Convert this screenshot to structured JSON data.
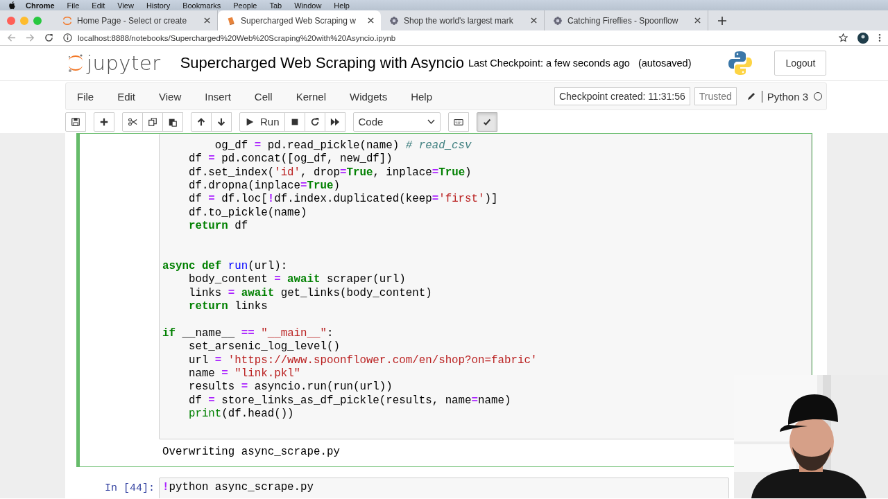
{
  "menu_bar": {
    "app": "Chrome",
    "items": [
      "File",
      "Edit",
      "View",
      "History",
      "Bookmarks",
      "People",
      "Tab",
      "Window",
      "Help"
    ]
  },
  "browser": {
    "tabs": [
      {
        "title": "Home Page - Select or create",
        "kind": "jupyter",
        "selected": false
      },
      {
        "title": "Supercharged Web Scraping w",
        "kind": "book",
        "selected": true
      },
      {
        "title": "Shop the world's largest mark",
        "kind": "flower",
        "selected": false
      },
      {
        "title": "Catching Fireflies - Spoonflow",
        "kind": "flower",
        "selected": false
      }
    ],
    "address": "localhost:8888/notebooks/Supercharged%20Web%20Scraping%20with%20Asyncio.ipynb"
  },
  "notebook": {
    "logo_text": "jupyter",
    "title": "Supercharged Web Scraping with Asyncio",
    "checkpoint": "Last Checkpoint: a few seconds ago",
    "autosave": "(autosaved)",
    "logout": "Logout",
    "menu": [
      "File",
      "Edit",
      "View",
      "Insert",
      "Cell",
      "Kernel",
      "Widgets",
      "Help"
    ],
    "checkpoint_notice": "Checkpoint created: 11:31:56",
    "trusted": "Trusted",
    "kernel": "Python 3",
    "kernel_busy": false,
    "toolbar": [
      [
        {
          "kind": "save",
          "active": false
        }
      ],
      [
        {
          "kind": "insert",
          "active": false
        }
      ],
      [
        {
          "kind": "cut",
          "active": false
        },
        {
          "kind": "copy",
          "active": false
        },
        {
          "kind": "paste",
          "active": false
        }
      ],
      [
        {
          "kind": "up",
          "active": false
        },
        {
          "kind": "down",
          "active": false
        }
      ],
      [
        {
          "kind": "run",
          "label": "Run",
          "active": false
        },
        {
          "kind": "stop",
          "active": false
        },
        {
          "kind": "restart",
          "active": false
        },
        {
          "kind": "run-all",
          "active": false
        }
      ],
      [
        {
          "kind": "select",
          "value": "Code",
          "active": false
        }
      ],
      [
        {
          "kind": "keyboard",
          "active": false
        }
      ],
      [
        {
          "kind": "spellcheck",
          "active": true
        }
      ]
    ]
  },
  "cells": [
    {
      "selected": true,
      "lines": [
        {
          "tokens": [
            {
              "kind": "plain",
              "text": "        og_df "
            },
            {
              "kind": "op",
              "text": "="
            },
            {
              "kind": "plain",
              "text": " pd.read_pickle(name) "
            },
            {
              "kind": "comment",
              "text": "# read_csv"
            }
          ]
        },
        {
          "tokens": [
            {
              "kind": "plain",
              "text": "    df "
            },
            {
              "kind": "op",
              "text": "="
            },
            {
              "kind": "plain",
              "text": " pd.concat([og_df, new_df])"
            }
          ]
        },
        {
          "tokens": [
            {
              "kind": "plain",
              "text": "    df.set_index("
            },
            {
              "kind": "str",
              "text": "'id'"
            },
            {
              "kind": "plain",
              "text": ", drop"
            },
            {
              "kind": "op",
              "text": "="
            },
            {
              "kind": "kw",
              "text": "True"
            },
            {
              "kind": "plain",
              "text": ", inplace"
            },
            {
              "kind": "op",
              "text": "="
            },
            {
              "kind": "kw",
              "text": "True"
            },
            {
              "kind": "plain",
              "text": ")"
            }
          ]
        },
        {
          "tokens": [
            {
              "kind": "plain",
              "text": "    df.dropna(inplace"
            },
            {
              "kind": "op",
              "text": "="
            },
            {
              "kind": "kw",
              "text": "True"
            },
            {
              "kind": "plain",
              "text": ")"
            }
          ]
        },
        {
          "tokens": [
            {
              "kind": "plain",
              "text": "    df "
            },
            {
              "kind": "op",
              "text": "="
            },
            {
              "kind": "plain",
              "text": " df.loc["
            },
            {
              "kind": "op",
              "text": "!"
            },
            {
              "kind": "plain",
              "text": "df.index.duplicated(keep"
            },
            {
              "kind": "op",
              "text": "="
            },
            {
              "kind": "str",
              "text": "'first'"
            },
            {
              "kind": "plain",
              "text": ")]"
            }
          ]
        },
        {
          "tokens": [
            {
              "kind": "plain",
              "text": "    df.to_pickle(name)"
            }
          ]
        },
        {
          "tokens": [
            {
              "kind": "kw",
              "text": "    return"
            },
            {
              "kind": "plain",
              "text": " df"
            }
          ]
        },
        {
          "kind": "blank"
        },
        {
          "kind": "blank"
        },
        {
          "tokens": [
            {
              "kind": "kw",
              "text": "async def "
            },
            {
              "kind": "def",
              "text": "run"
            },
            {
              "kind": "plain",
              "text": "(url):"
            }
          ]
        },
        {
          "tokens": [
            {
              "kind": "plain",
              "text": "    body_content "
            },
            {
              "kind": "op",
              "text": "="
            },
            {
              "kind": "kw",
              "text": " await"
            },
            {
              "kind": "plain",
              "text": " scraper(url)"
            }
          ]
        },
        {
          "tokens": [
            {
              "kind": "plain",
              "text": "    links "
            },
            {
              "kind": "op",
              "text": "="
            },
            {
              "kind": "kw",
              "text": " await"
            },
            {
              "kind": "plain",
              "text": " get_links(body_content)"
            }
          ]
        },
        {
          "tokens": [
            {
              "kind": "kw",
              "text": "    return"
            },
            {
              "kind": "plain",
              "text": " links"
            }
          ]
        },
        {
          "kind": "blank"
        },
        {
          "tokens": [
            {
              "kind": "kw",
              "text": "if"
            },
            {
              "kind": "plain",
              "text": " __name__ "
            },
            {
              "kind": "op",
              "text": "=="
            },
            {
              "kind": "str",
              "text": " \"__main__\""
            },
            {
              "kind": "plain",
              "text": ":"
            }
          ]
        },
        {
          "tokens": [
            {
              "kind": "plain",
              "text": "    set_arsenic_log_level()"
            }
          ]
        },
        {
          "tokens": [
            {
              "kind": "plain",
              "text": "    url "
            },
            {
              "kind": "op",
              "text": "="
            },
            {
              "kind": "str",
              "text": " 'https://www.spoonflower.com/en/shop?on=fabric'"
            }
          ]
        },
        {
          "tokens": [
            {
              "kind": "plain",
              "text": "    name "
            },
            {
              "kind": "op",
              "text": "="
            },
            {
              "kind": "str",
              "text": " \"link.pkl\""
            }
          ]
        },
        {
          "tokens": [
            {
              "kind": "plain",
              "text": "    results "
            },
            {
              "kind": "op",
              "text": "="
            },
            {
              "kind": "plain",
              "text": " asyncio.run(run(url))"
            }
          ]
        },
        {
          "tokens": [
            {
              "kind": "plain",
              "text": "    df "
            },
            {
              "kind": "op",
              "text": "="
            },
            {
              "kind": "plain",
              "text": " store_links_as_df_pickle(results, name"
            },
            {
              "kind": "op",
              "text": "="
            },
            {
              "kind": "plain",
              "text": "name)"
            }
          ]
        },
        {
          "tokens": [
            {
              "kind": "builtin",
              "text": "    print"
            },
            {
              "kind": "plain",
              "text": "(df.head())"
            }
          ]
        }
      ],
      "output": "Overwriting async_scrape.py"
    },
    {
      "selected": false,
      "prompt": "In [44]:",
      "lines": [
        {
          "tokens": [
            {
              "kind": "op",
              "text": "!"
            },
            {
              "kind": "plain",
              "text": "python async_scrape.py"
            }
          ]
        }
      ]
    }
  ]
}
